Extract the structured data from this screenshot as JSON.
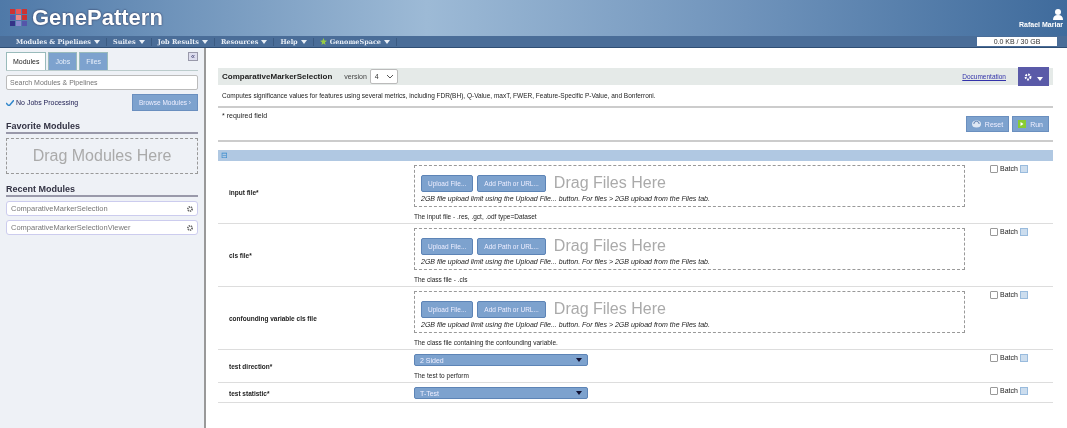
{
  "header": {
    "logo": "GenePattern",
    "user": "Rafael Mariar",
    "storage": {
      "text": "0.0 KB / 30 GB"
    }
  },
  "nav": [
    {
      "label": "Modules & Pipelines",
      "icon": false
    },
    {
      "label": "Suites",
      "icon": false
    },
    {
      "label": "Job Results",
      "icon": false
    },
    {
      "label": "Resources",
      "icon": false
    },
    {
      "label": "Help",
      "icon": false
    },
    {
      "label": "GenomeSpace",
      "icon": true
    }
  ],
  "sidebar": {
    "tabs": [
      {
        "label": "Modules",
        "selected": true
      },
      {
        "label": "Jobs",
        "selected": false
      },
      {
        "label": "Files",
        "selected": false
      }
    ],
    "collapse": "«",
    "search": {
      "placeholder": "Search Modules & Pipelines"
    },
    "status": "No Jobs Processing",
    "browse": "Browse Modules ›",
    "favorites_title": "Favorite Modules",
    "favorites_drop": "Drag Modules Here",
    "recent_title": "Recent Modules",
    "recent": [
      "ComparativeMarkerSelection",
      "ComparativeMarkerSelectionViewer"
    ]
  },
  "module": {
    "name": "ComparativeMarkerSelection",
    "version_label": "version",
    "version": "4",
    "documentation": "Documentation",
    "description": "Computes significance values for features using several metrics, including FDR(BH), Q-Value, maxT, FWER, Feature-Specific P-Value, and Bonferroni.",
    "required_note": "* required field",
    "reset": "Reset",
    "run": "Run",
    "section_toggle": "⊟",
    "params": [
      {
        "kind": "file",
        "name": "input file*",
        "upload": "Upload File...",
        "add_path": "Add Path or URL...",
        "drop": "Drag Files Here",
        "limit": "2GB file upload limit using the Upload File... button. For files > 2GB upload from the Files tab.",
        "description": "The input file - .res, .gct, .odf type=Dataset",
        "batch_label": "Batch",
        "batch": false
      },
      {
        "kind": "file",
        "name": "cls file*",
        "upload": "Upload File...",
        "add_path": "Add Path or URL...",
        "drop": "Drag Files Here",
        "limit": "2GB file upload limit using the Upload File... button. For files > 2GB upload from the Files tab.",
        "description": "The class file - .cls",
        "batch_label": "Batch",
        "batch": false
      },
      {
        "kind": "file",
        "name": "confounding variable cls file",
        "upload": "Upload File...",
        "add_path": "Add Path or URL...",
        "drop": "Drag Files Here",
        "limit": "2GB file upload limit using the Upload File... button. For files > 2GB upload from the Files tab.",
        "description": "The class file containing the confounding variable.",
        "batch_label": "Batch",
        "batch": false
      },
      {
        "kind": "choice",
        "name": "test direction*",
        "value": "2 Sided",
        "description": "The test to perform",
        "batch_label": "Batch",
        "batch": false
      },
      {
        "kind": "choice",
        "name": "test statistic*",
        "value": "T-Test",
        "batch_label": "Batch",
        "batch": false
      }
    ]
  }
}
